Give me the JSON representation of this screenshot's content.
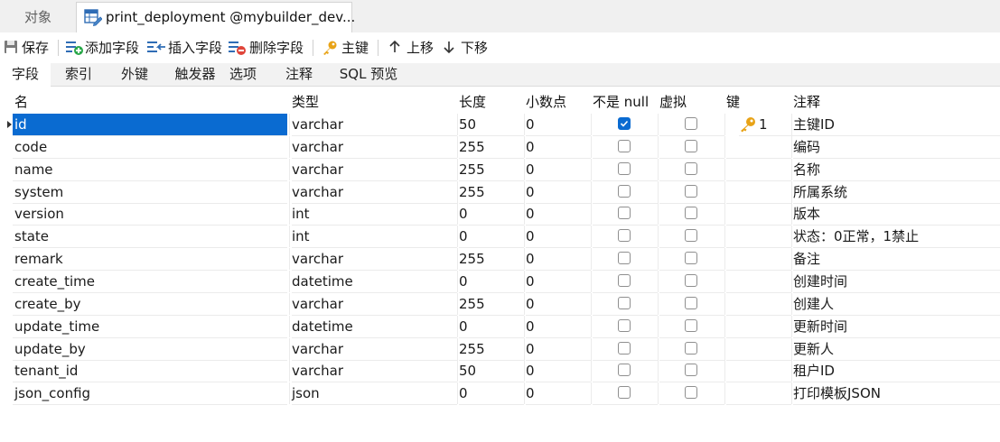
{
  "doc_tabs": {
    "objects_label": "对象",
    "active_label": "print_deployment @mybuilder_dev..."
  },
  "toolbar": {
    "save": "保存",
    "add_field": "添加字段",
    "insert_field": "插入字段",
    "delete_field": "删除字段",
    "primary_key": "主键",
    "move_up": "上移",
    "move_down": "下移"
  },
  "subtabs": [
    "字段",
    "索引",
    "外键",
    "触发器",
    "选项",
    "注释",
    "SQL 预览"
  ],
  "columns": {
    "name": "名",
    "type": "类型",
    "length": "长度",
    "decimals": "小数点",
    "not_null": "不是 null",
    "virtual": "虚拟",
    "key": "键",
    "comment": "注释"
  },
  "rows": [
    {
      "name": "id",
      "type": "varchar",
      "length": "50",
      "decimals": "0",
      "not_null": true,
      "virtual": false,
      "key": "1",
      "comment": "主键ID"
    },
    {
      "name": "code",
      "type": "varchar",
      "length": "255",
      "decimals": "0",
      "not_null": false,
      "virtual": false,
      "key": "",
      "comment": "编码"
    },
    {
      "name": "name",
      "type": "varchar",
      "length": "255",
      "decimals": "0",
      "not_null": false,
      "virtual": false,
      "key": "",
      "comment": "名称"
    },
    {
      "name": "system",
      "type": "varchar",
      "length": "255",
      "decimals": "0",
      "not_null": false,
      "virtual": false,
      "key": "",
      "comment": "所属系统"
    },
    {
      "name": "version",
      "type": "int",
      "length": "0",
      "decimals": "0",
      "not_null": false,
      "virtual": false,
      "key": "",
      "comment": "版本"
    },
    {
      "name": "state",
      "type": "int",
      "length": "0",
      "decimals": "0",
      "not_null": false,
      "virtual": false,
      "key": "",
      "comment": "状态：0正常，1禁止"
    },
    {
      "name": "remark",
      "type": "varchar",
      "length": "255",
      "decimals": "0",
      "not_null": false,
      "virtual": false,
      "key": "",
      "comment": "备注"
    },
    {
      "name": "create_time",
      "type": "datetime",
      "length": "0",
      "decimals": "0",
      "not_null": false,
      "virtual": false,
      "key": "",
      "comment": "创建时间"
    },
    {
      "name": "create_by",
      "type": "varchar",
      "length": "255",
      "decimals": "0",
      "not_null": false,
      "virtual": false,
      "key": "",
      "comment": "创建人"
    },
    {
      "name": "update_time",
      "type": "datetime",
      "length": "0",
      "decimals": "0",
      "not_null": false,
      "virtual": false,
      "key": "",
      "comment": "更新时间"
    },
    {
      "name": "update_by",
      "type": "varchar",
      "length": "255",
      "decimals": "0",
      "not_null": false,
      "virtual": false,
      "key": "",
      "comment": "更新人"
    },
    {
      "name": "tenant_id",
      "type": "varchar",
      "length": "50",
      "decimals": "0",
      "not_null": false,
      "virtual": false,
      "key": "",
      "comment": "租户ID"
    },
    {
      "name": "json_config",
      "type": "json",
      "length": "0",
      "decimals": "0",
      "not_null": false,
      "virtual": false,
      "key": "",
      "comment": "打印模板JSON"
    }
  ],
  "selected_row": 0,
  "colors": {
    "accent": "#0a6bd1",
    "key_icon": "#e8a317"
  }
}
